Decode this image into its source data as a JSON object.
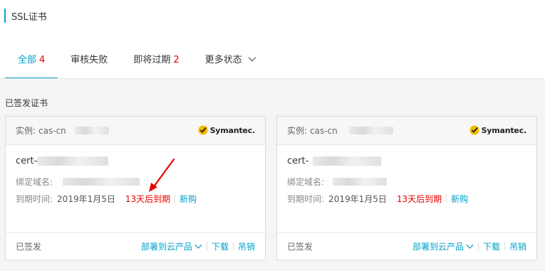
{
  "header": {
    "title": "SSL证书"
  },
  "tabs": [
    {
      "label": "全部",
      "count": "4"
    },
    {
      "label": "审核失败",
      "count": ""
    },
    {
      "label": "即将过期",
      "count": "2"
    },
    {
      "label": "更多状态",
      "count": ""
    }
  ],
  "section": {
    "title": "已签发证书"
  },
  "cards": [
    {
      "instance_label": "实例:",
      "instance_value": "cas-cn",
      "brand": "Symantec.",
      "cert_prefix": "cert-",
      "domain_label": "绑定域名:",
      "expiry_label": "到期时间:",
      "expiry_date": "2019年1月5日",
      "expiry_notice": "13天后到期",
      "renew": "新购",
      "status": "已签发",
      "deploy": "部署到云产品",
      "download": "下载",
      "revoke": "吊销"
    },
    {
      "instance_label": "实例:",
      "instance_value": "cas-cn",
      "brand": "Symantec.",
      "cert_prefix": "cert-",
      "domain_label": "绑定域名:",
      "expiry_label": "到期时间:",
      "expiry_date": "2019年1月5日",
      "expiry_notice": "13天后到期",
      "renew": "新购",
      "status": "已签发",
      "deploy": "部署到云产品",
      "download": "下载",
      "revoke": "吊销"
    }
  ],
  "colors": {
    "accent": "#00a2ca",
    "warning": "#e60000",
    "brand_check": "#f5b800",
    "annotation_arrow": "#e60000"
  }
}
